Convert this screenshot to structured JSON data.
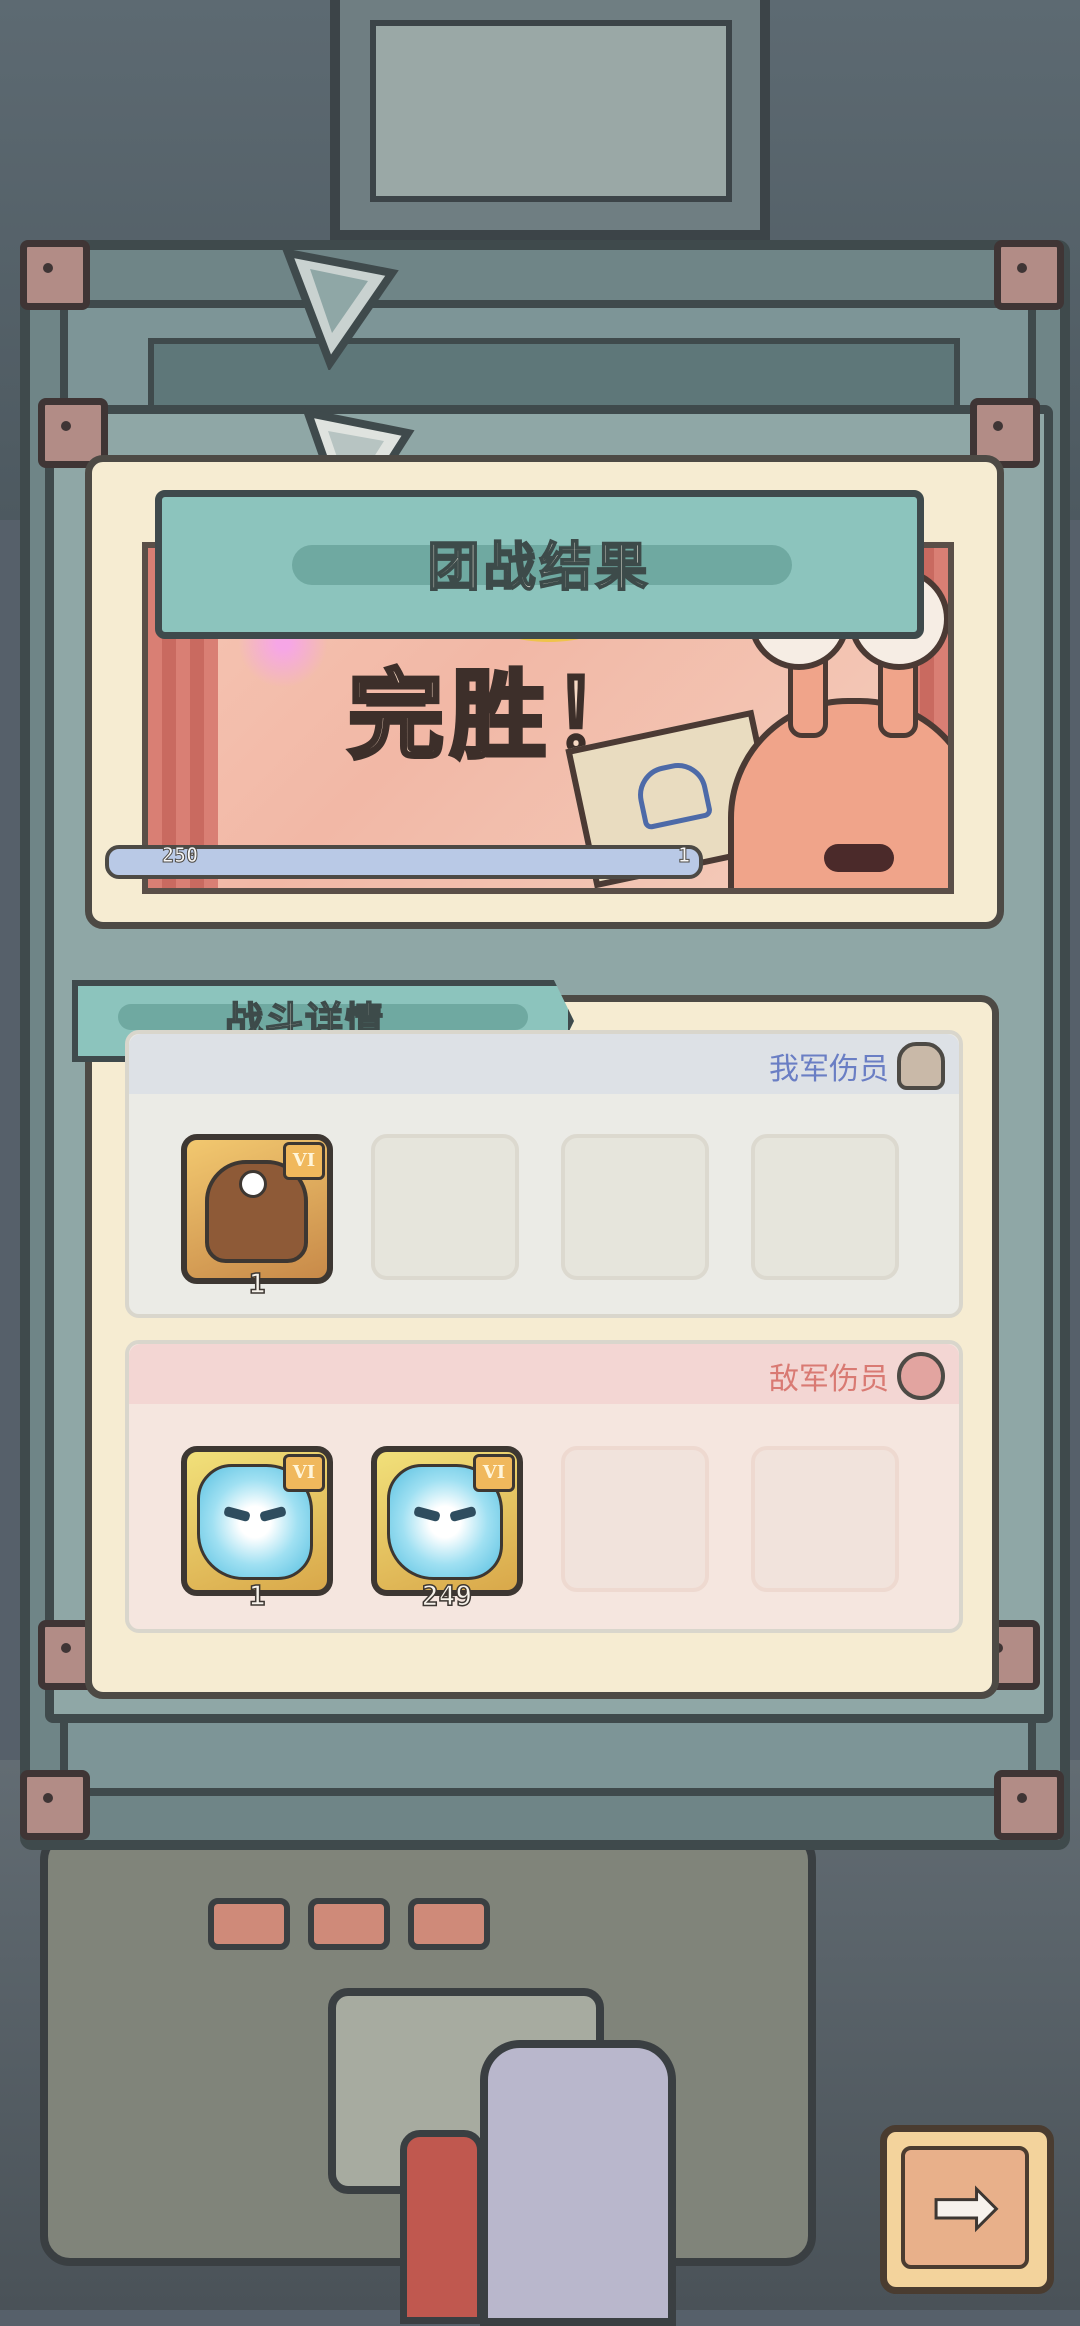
{
  "result": {
    "title": "团战结果",
    "outcome": "完胜！",
    "progress": {
      "left_value": "250",
      "right_value": "1"
    }
  },
  "details": {
    "tab_label": "战斗详情",
    "ally": {
      "label": "我军伤员",
      "units": [
        {
          "rank": "VI",
          "count": "1",
          "icon": "dragon-unit-icon"
        }
      ],
      "empty_slots": 3
    },
    "enemy": {
      "label": "敌军伤员",
      "units": [
        {
          "rank": "VI",
          "count": "1",
          "icon": "frost-spirit-unit-icon"
        },
        {
          "rank": "VI",
          "count": "249",
          "icon": "frost-spirit-unit-icon"
        }
      ],
      "empty_slots": 2
    }
  },
  "controls": {
    "next_icon": "arrow-right-icon",
    "next_glyph": "➡"
  },
  "colors": {
    "ally_label": "#6a7ec4",
    "enemy_label": "#d97a73",
    "banner": "#8cc4bd"
  }
}
